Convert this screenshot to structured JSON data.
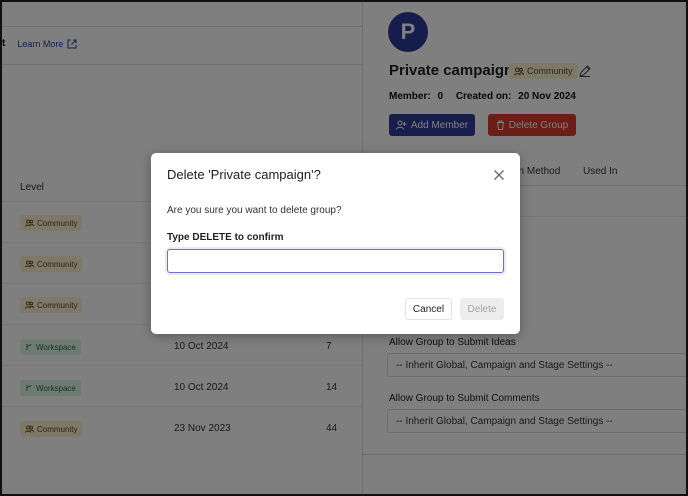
{
  "left_table": {
    "header_fragment": "t",
    "learn_more_label": "Learn More",
    "level_header": "Level",
    "rows": [
      {
        "level": "Community",
        "type": "community",
        "date": "",
        "count": ""
      },
      {
        "level": "Community",
        "type": "community",
        "date": "",
        "count": ""
      },
      {
        "level": "Community",
        "type": "community",
        "date": "",
        "count": ""
      },
      {
        "level": "Workspace",
        "type": "workspace",
        "date": "10 Oct 2024",
        "count": "7"
      },
      {
        "level": "Workspace",
        "type": "workspace",
        "date": "10 Oct 2024",
        "count": "14"
      },
      {
        "level": "Community",
        "type": "community",
        "date": "23 Nov 2023",
        "count": "44"
      }
    ]
  },
  "group": {
    "avatar_letter": "P",
    "name": "Private campaign",
    "level_badge": "Community",
    "member_label": "Member:",
    "member_count": "0",
    "created_label": "Created on:",
    "created_date": "20 Nov 2024",
    "add_member_label": "Add Member",
    "delete_group_label": "Delete Group",
    "tabs": [
      "gn Method",
      "Used In"
    ],
    "settings": [
      {
        "label": "Allow Group to Submit Ideas",
        "value": "-- Inherit Global, Campaign and Stage Settings --"
      },
      {
        "label": "Allow Group to Submit Comments",
        "value": "-- Inherit Global, Campaign and Stage Settings --"
      }
    ]
  },
  "modal": {
    "title": "Delete 'Private campaign'?",
    "message": "Are you sure you want to delete group?",
    "input_label": "Type DELETE to confirm",
    "input_value": "",
    "cancel_label": "Cancel",
    "delete_label": "Delete"
  },
  "colors": {
    "primary": "#2f3d9c",
    "danger": "#d73a2f",
    "community_badge_bg": "#fdf0d3",
    "workspace_badge_bg": "#dcf4e4"
  }
}
